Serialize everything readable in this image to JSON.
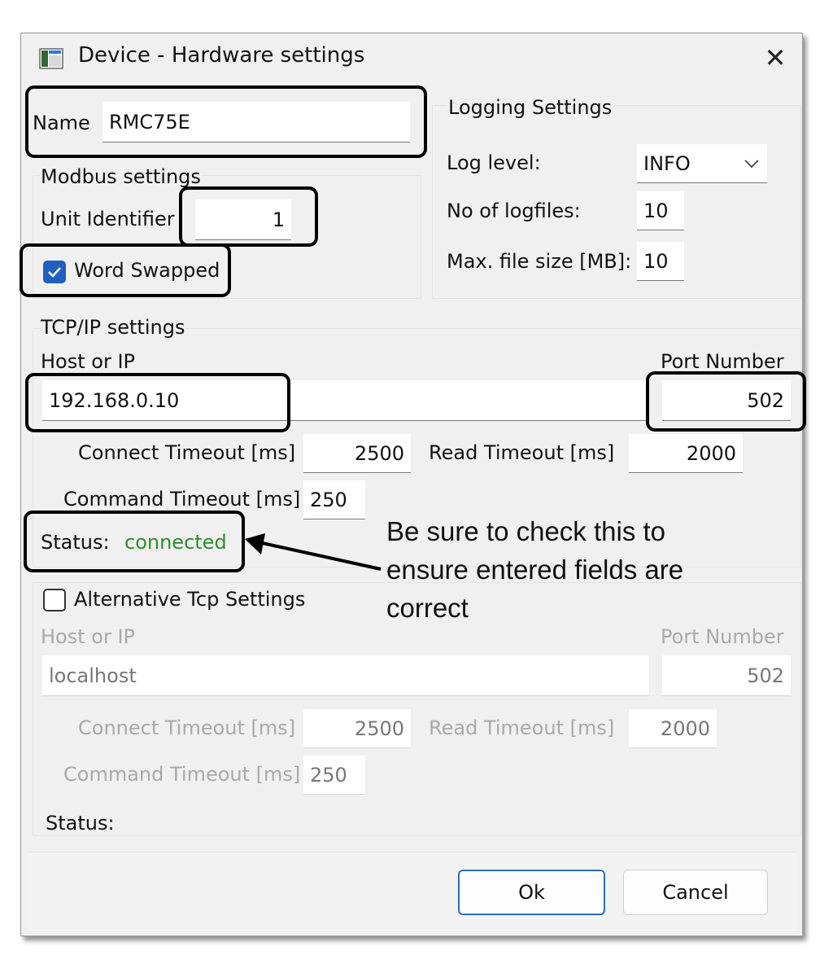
{
  "window": {
    "title": "Device - Hardware settings",
    "close_glyph": "✕"
  },
  "name_field": {
    "label": "Name",
    "value": "RMC75E"
  },
  "modbus": {
    "group_label": "Modbus settings",
    "unit_identifier_label": "Unit Identifier",
    "unit_identifier_value": "1",
    "word_swapped_label": "Word Swapped",
    "word_swapped_checked": true
  },
  "logging": {
    "group_label": "Logging Settings",
    "log_level_label": "Log level:",
    "log_level_value": "INFO",
    "logfiles_label": "No of logfiles:",
    "logfiles_value": "10",
    "max_size_label": "Max. file size [MB]:",
    "max_size_value": "10"
  },
  "tcp": {
    "group_label": "TCP/IP settings",
    "host_label": "Host or IP",
    "host_value": "192.168.0.10",
    "port_label": "Port Number",
    "port_value": "502",
    "connect_timeout_label": "Connect Timeout [ms]",
    "connect_timeout_value": "2500",
    "read_timeout_label": "Read Timeout [ms]",
    "read_timeout_value": "2000",
    "command_timeout_label": "Command Timeout [ms]",
    "command_timeout_value": "250",
    "status_label": "Status:",
    "status_value": "connected",
    "status_color": "#2e8b2e"
  },
  "alt_tcp": {
    "checkbox_label": "Alternative Tcp Settings",
    "checked": false,
    "host_label": "Host or IP",
    "host_value": "localhost",
    "port_label": "Port Number",
    "port_value": "502",
    "connect_timeout_label": "Connect Timeout [ms]",
    "connect_timeout_value": "2500",
    "read_timeout_label": "Read Timeout [ms]",
    "read_timeout_value": "2000",
    "command_timeout_label": "Command Timeout [ms]",
    "command_timeout_value": "250",
    "status_label": "Status:"
  },
  "buttons": {
    "ok": "Ok",
    "cancel": "Cancel"
  },
  "annotation": {
    "line1": "Be sure to check this to",
    "line2": "ensure entered fields are",
    "line3": "correct"
  },
  "colors": {
    "accent": "#1f5fbf",
    "highlight_outline": "#000000"
  }
}
